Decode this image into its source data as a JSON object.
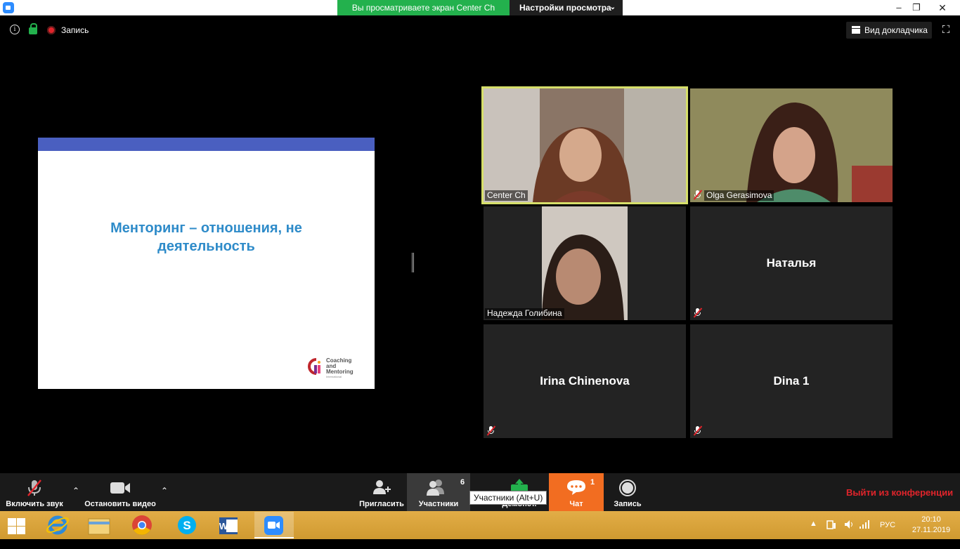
{
  "window": {
    "share_banner": "Вы просматриваете экран Center Ch",
    "view_options": "Настройки просмотра",
    "minimize": "–",
    "maximize": "❐",
    "close": "✕"
  },
  "topbar": {
    "recording_label": "Запись",
    "speaker_view": "Вид докладчика"
  },
  "slide": {
    "title_line1": "Менторинг – отношения, не",
    "title_line2": "деятельность",
    "logo_line1": "Coaching",
    "logo_line2": "and",
    "logo_line3": "Mentoring",
    "logo_sub": "International",
    "band_color": "#4a5fc0",
    "title_color": "#2e8bc9"
  },
  "participants": [
    {
      "name": "Center Ch",
      "video": true,
      "active_speaker": true,
      "muted": false
    },
    {
      "name": "Olga Gerasimova",
      "video": true,
      "active_speaker": false,
      "muted": true
    },
    {
      "name": "Надежда Голибина",
      "video": true,
      "active_speaker": false,
      "muted": false
    },
    {
      "name": "Наталья",
      "video": false,
      "active_speaker": false,
      "muted": true
    },
    {
      "name": "Irina Chinenova",
      "video": false,
      "active_speaker": false,
      "muted": true
    },
    {
      "name": "Dina 1",
      "video": false,
      "active_speaker": false,
      "muted": true
    }
  ],
  "toolbar": {
    "unmute": "Включить звук",
    "stop_video": "Остановить видео",
    "invite": "Пригласить",
    "participants": "Участники",
    "participants_count": "6",
    "share": "Демонст.",
    "chat": "Чат",
    "chat_count": "1",
    "record": "Запись",
    "leave": "Выйти из конференции",
    "tooltip": "Участники (Alt+U)"
  },
  "taskbar": {
    "apps": [
      "internet-explorer-icon",
      "file-explorer-icon",
      "chrome-icon",
      "skype-icon",
      "word-icon",
      "zoom-icon"
    ],
    "language": "РУС",
    "time": "20:10",
    "date": "27.11.2019"
  },
  "colors": {
    "accent_green": "#23b14d",
    "active_speaker": "#d6df6a",
    "chat_orange": "#f26d21",
    "leave_red": "#e0242b",
    "taskbar": "#d9a33a"
  }
}
